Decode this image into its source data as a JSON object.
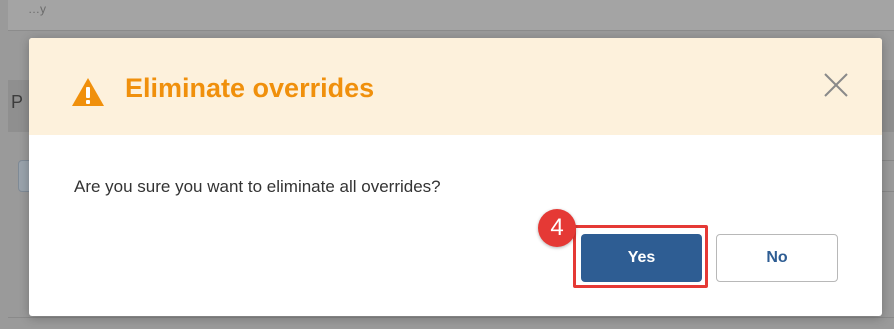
{
  "background": {
    "top_row_text": "…y",
    "section_letter": "P"
  },
  "dialog": {
    "title": "Eliminate overrides",
    "message": "Are you sure you want to eliminate all overrides?",
    "title_icon": "warning-triangle-icon",
    "close_icon": "close-icon",
    "yes_label": "Yes",
    "no_label": "No"
  },
  "annotation": {
    "step_number": "4"
  },
  "colors": {
    "header_bg": "#fdf1dc",
    "title": "#f0900c",
    "primary_button": "#2e5d93",
    "highlight": "#e53935"
  }
}
